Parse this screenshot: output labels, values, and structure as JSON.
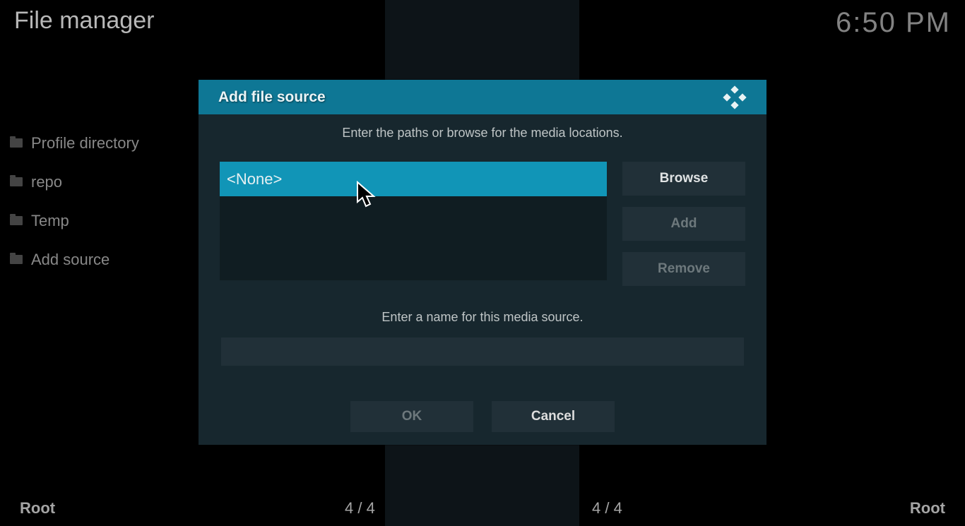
{
  "header": {
    "title": "File manager",
    "clock": "6:50 PM"
  },
  "file_list": [
    {
      "label": "Profile directory"
    },
    {
      "label": "repo"
    },
    {
      "label": "Temp"
    },
    {
      "label": "Add source"
    }
  ],
  "footer": {
    "left_label": "Root",
    "left_count": "4 / 4",
    "right_count": "4 / 4",
    "right_label": "Root"
  },
  "dialog": {
    "title": "Add file source",
    "instruction": "Enter the paths or browse for the media locations.",
    "path_value": "<None>",
    "buttons": {
      "browse": "Browse",
      "add": "Add",
      "remove": "Remove"
    },
    "name_instruction": "Enter a name for this media source.",
    "name_value": "",
    "ok": "OK",
    "cancel": "Cancel"
  }
}
